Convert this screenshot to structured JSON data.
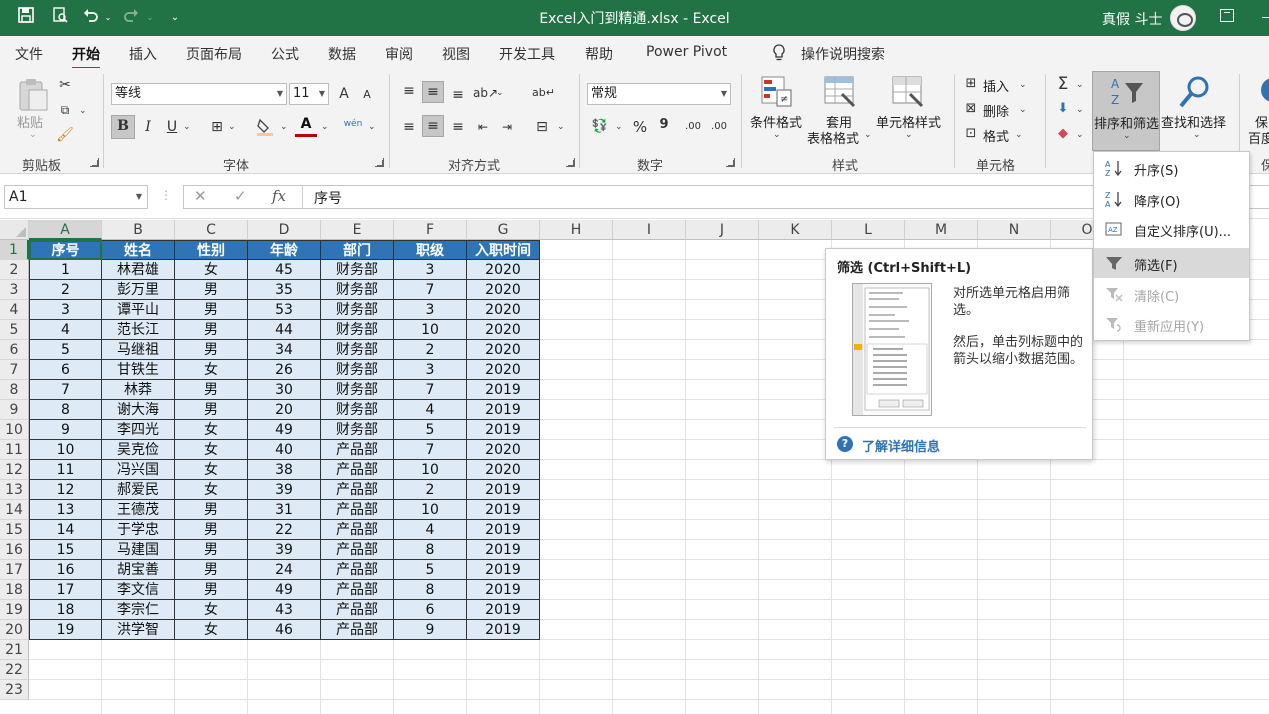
{
  "window": {
    "title": "Excel入门到精通.xlsx  -  Excel",
    "user_name": "真假 斗士"
  },
  "tabs": [
    "文件",
    "开始",
    "插入",
    "页面布局",
    "公式",
    "数据",
    "审阅",
    "视图",
    "开发工具",
    "帮助",
    "Power Pivot"
  ],
  "active_tab": "开始",
  "tell_me": "操作说明搜索",
  "ribbon": {
    "clipboard": {
      "paste": "粘贴",
      "label": "剪贴板"
    },
    "font": {
      "name": "等线",
      "size": "11",
      "label": "字体",
      "grow": "A",
      "shrink": "A",
      "bold": "B",
      "italic": "I",
      "underline": "U",
      "font_color": "A",
      "phonetic": "wén"
    },
    "alignment": {
      "label": "对齐方式"
    },
    "number": {
      "format": "常规",
      "label": "数字",
      "percent": "%",
      "comma": "9",
      "inc_decimal": ".00",
      "dec_decimal": ".00"
    },
    "styles": {
      "conditional": "条件格式",
      "table_format_1": "套用",
      "table_format_2": "表格格式",
      "cell_style": "单元格样式",
      "label": "样式"
    },
    "cells": {
      "insert": "插入",
      "delete": "删除",
      "format": "格式",
      "label": "单元格"
    },
    "editing": {
      "sort_filter": "排序和筛选",
      "find_select": "查找和选择",
      "autosum": "Σ"
    },
    "extra": {
      "label_1": "保",
      "label_2": "百度",
      "group_label": "保"
    }
  },
  "formula_bar": {
    "name_box": "A1",
    "fx": "fx",
    "cancel": "✕",
    "enter": "✓",
    "content": "序号"
  },
  "grid": {
    "columns": [
      "A",
      "B",
      "C",
      "D",
      "E",
      "F",
      "G",
      "H",
      "I",
      "J",
      "K",
      "L",
      "M",
      "N",
      "O"
    ],
    "rows": [
      "1",
      "2",
      "3",
      "4",
      "5",
      "6",
      "7",
      "8",
      "9",
      "10",
      "11",
      "12",
      "13",
      "14",
      "15",
      "16",
      "17",
      "18",
      "19",
      "20",
      "21",
      "22",
      "23"
    ],
    "header": [
      "序号",
      "姓名",
      "性别",
      "年龄",
      "部门",
      "职级",
      "入职时间"
    ],
    "data": [
      [
        "1",
        "林君雄",
        "女",
        "45",
        "财务部",
        "3",
        "2020"
      ],
      [
        "2",
        "彭万里",
        "男",
        "35",
        "财务部",
        "7",
        "2020"
      ],
      [
        "3",
        "谭平山",
        "男",
        "53",
        "财务部",
        "3",
        "2020"
      ],
      [
        "4",
        "范长江",
        "男",
        "44",
        "财务部",
        "10",
        "2020"
      ],
      [
        "5",
        "马继祖",
        "男",
        "34",
        "财务部",
        "2",
        "2020"
      ],
      [
        "6",
        "甘铁生",
        "女",
        "26",
        "财务部",
        "3",
        "2020"
      ],
      [
        "7",
        "林莽",
        "男",
        "30",
        "财务部",
        "7",
        "2019"
      ],
      [
        "8",
        "谢大海",
        "男",
        "20",
        "财务部",
        "4",
        "2019"
      ],
      [
        "9",
        "李四光",
        "女",
        "49",
        "财务部",
        "5",
        "2019"
      ],
      [
        "10",
        "吴克俭",
        "女",
        "40",
        "产品部",
        "7",
        "2020"
      ],
      [
        "11",
        "冯兴国",
        "女",
        "38",
        "产品部",
        "10",
        "2020"
      ],
      [
        "12",
        "郝爱民",
        "女",
        "39",
        "产品部",
        "2",
        "2019"
      ],
      [
        "13",
        "王德茂",
        "男",
        "31",
        "产品部",
        "10",
        "2019"
      ],
      [
        "14",
        "于学忠",
        "男",
        "22",
        "产品部",
        "4",
        "2019"
      ],
      [
        "15",
        "马建国",
        "男",
        "39",
        "产品部",
        "8",
        "2019"
      ],
      [
        "16",
        "胡宝善",
        "男",
        "24",
        "产品部",
        "5",
        "2019"
      ],
      [
        "17",
        "李文信",
        "男",
        "49",
        "产品部",
        "8",
        "2019"
      ],
      [
        "18",
        "李宗仁",
        "女",
        "43",
        "产品部",
        "6",
        "2019"
      ],
      [
        "19",
        "洪学智",
        "女",
        "46",
        "产品部",
        "9",
        "2019"
      ]
    ]
  },
  "sort_menu": {
    "items": [
      {
        "label": "升序(S)",
        "icon": "sort-ascending-icon",
        "disabled": false,
        "highlighted": false
      },
      {
        "label": "降序(O)",
        "icon": "sort-descending-icon",
        "disabled": false,
        "highlighted": false
      },
      {
        "label": "自定义排序(U)...",
        "icon": "custom-sort-icon",
        "disabled": false,
        "highlighted": false
      },
      {
        "label": "筛选(F)",
        "icon": "filter-icon",
        "disabled": false,
        "highlighted": true
      },
      {
        "label": "清除(C)",
        "icon": "clear-filter-icon",
        "disabled": true,
        "highlighted": false
      },
      {
        "label": "重新应用(Y)",
        "icon": "reapply-icon",
        "disabled": true,
        "highlighted": false
      }
    ]
  },
  "tooltip": {
    "title": "筛选 (Ctrl+Shift+L)",
    "desc1": "对所选单元格启用筛选。",
    "desc2": "然后，单击列标题中的箭头以缩小数据范围。",
    "link": "了解详细信息",
    "help": "?"
  },
  "colors": {
    "title_bar": "#217346",
    "header_fill": "#2f75b5",
    "data_fill": "#deebf7",
    "accent_green": "#217346",
    "link_blue": "#2e74b5"
  }
}
